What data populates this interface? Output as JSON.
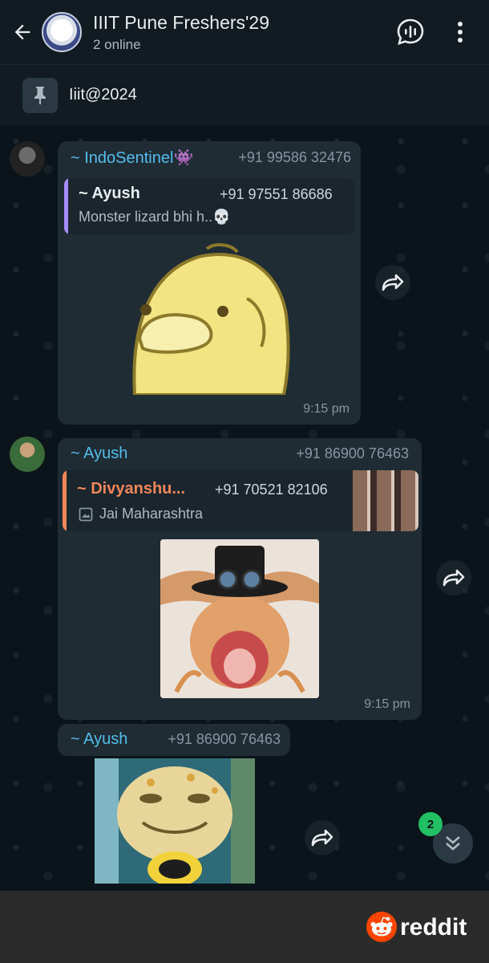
{
  "header": {
    "title": "IIIT Pune Freshers'29",
    "status": "2 online",
    "back_icon": "arrow-left-icon",
    "voice_chat_icon": "voice-chat-icon",
    "menu_icon": "more-vertical-icon"
  },
  "pinned": {
    "icon": "pin-icon",
    "text": "Iiit@2024"
  },
  "messages": [
    {
      "sender": "~ IndoSentinel👾",
      "phone": "+91 99586 32476",
      "quote": {
        "sender": "~ Ayush",
        "phone": "+91 97551 86686",
        "text": "Monster lizard bhi h..💀",
        "bar_color": "#a78bfa",
        "name_color": "#e9edef"
      },
      "media": "sticker-duck",
      "time": "9:15 pm"
    },
    {
      "sender": "~ Ayush",
      "phone": "+91 86900 76463",
      "quote": {
        "sender": "~ Divyanshu...",
        "phone": "+91 70521 82106",
        "text": "Jai Maharashtra",
        "text_icon": "image-icon",
        "bar_color": "#f0875a",
        "name_color": "#f0875a"
      },
      "media": "photo-gecko-hat",
      "time": "9:15 pm"
    },
    {
      "sender": "~ Ayush",
      "phone": "+91 86900 76463",
      "media": "photo-gecko-smile"
    }
  ],
  "scroll": {
    "unread_count": "2",
    "icon": "double-chevron-down-icon"
  },
  "footer": {
    "brand": "reddit"
  },
  "colors": {
    "accent": "#53bdeb",
    "bubble": "#1f2c34",
    "background": "#0b141a",
    "unread": "#21c063",
    "reddit": "#ff4500"
  }
}
